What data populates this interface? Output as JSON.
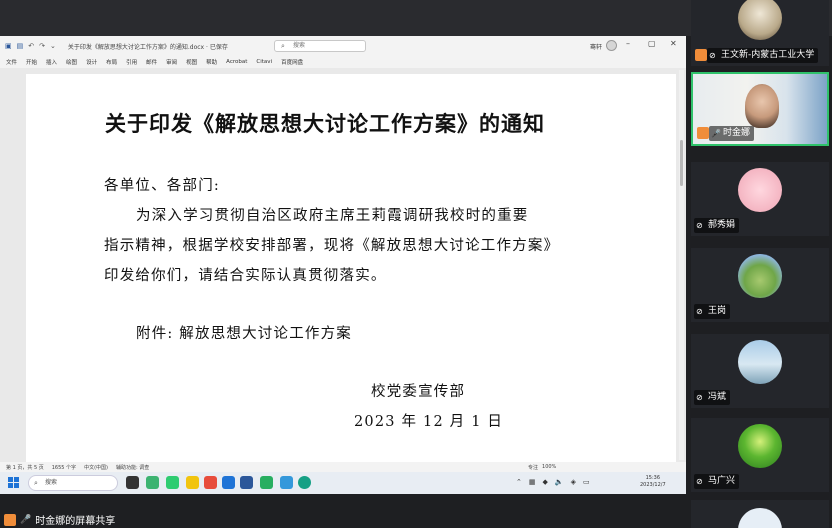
{
  "word": {
    "doc_name": "关于印发《解放思想大讨论工作方案》的通知.docx · 已保存",
    "search_placeholder": "搜索",
    "user": "骞轩",
    "tabs": [
      "文件",
      "开始",
      "插入",
      "绘图",
      "设计",
      "布局",
      "引用",
      "邮件",
      "审阅",
      "视图",
      "帮助",
      "Acrobat",
      "Citavi",
      "百度网盘"
    ],
    "status_page": "第 1 页，共 5 页",
    "status_words": "1655 个字",
    "status_lang": "中文(中国)",
    "status_a11y": "辅助功能: 调查",
    "status_focus": "专注",
    "zoom": "100%"
  },
  "document": {
    "title": "关于印发《解放思想大讨论工作方案》的通知",
    "salutation": "各单位、各部门:",
    "body_1": "为深入学习贯彻自治区政府主席王莉霞调研我校时的重要",
    "body_2": "指示精神，根据学校安排部署，现将《解放思想大讨论工作方案》",
    "body_3": "印发给你们，请结合实际认真贯彻落实。",
    "attachment": "附件: 解放思想大讨论工作方案",
    "signature_org": "校党委宣传部",
    "signature_date": "2023 年 12 月 1 日"
  },
  "taskbar": {
    "search": "搜索",
    "time": "15:36",
    "date": "2023/12/7"
  },
  "share_label": "时金娜的屏幕共享",
  "participants": [
    {
      "name": "王文新-内蒙古工业大学"
    },
    {
      "name": "时金娜"
    },
    {
      "name": "郝秀娟"
    },
    {
      "name": "王岗"
    },
    {
      "name": "冯斌"
    },
    {
      "name": "马广兴"
    }
  ],
  "colors": {
    "accent": "#2fc26b",
    "host_badge": "#f08d3a",
    "windows_blue": "#1e73d6"
  }
}
